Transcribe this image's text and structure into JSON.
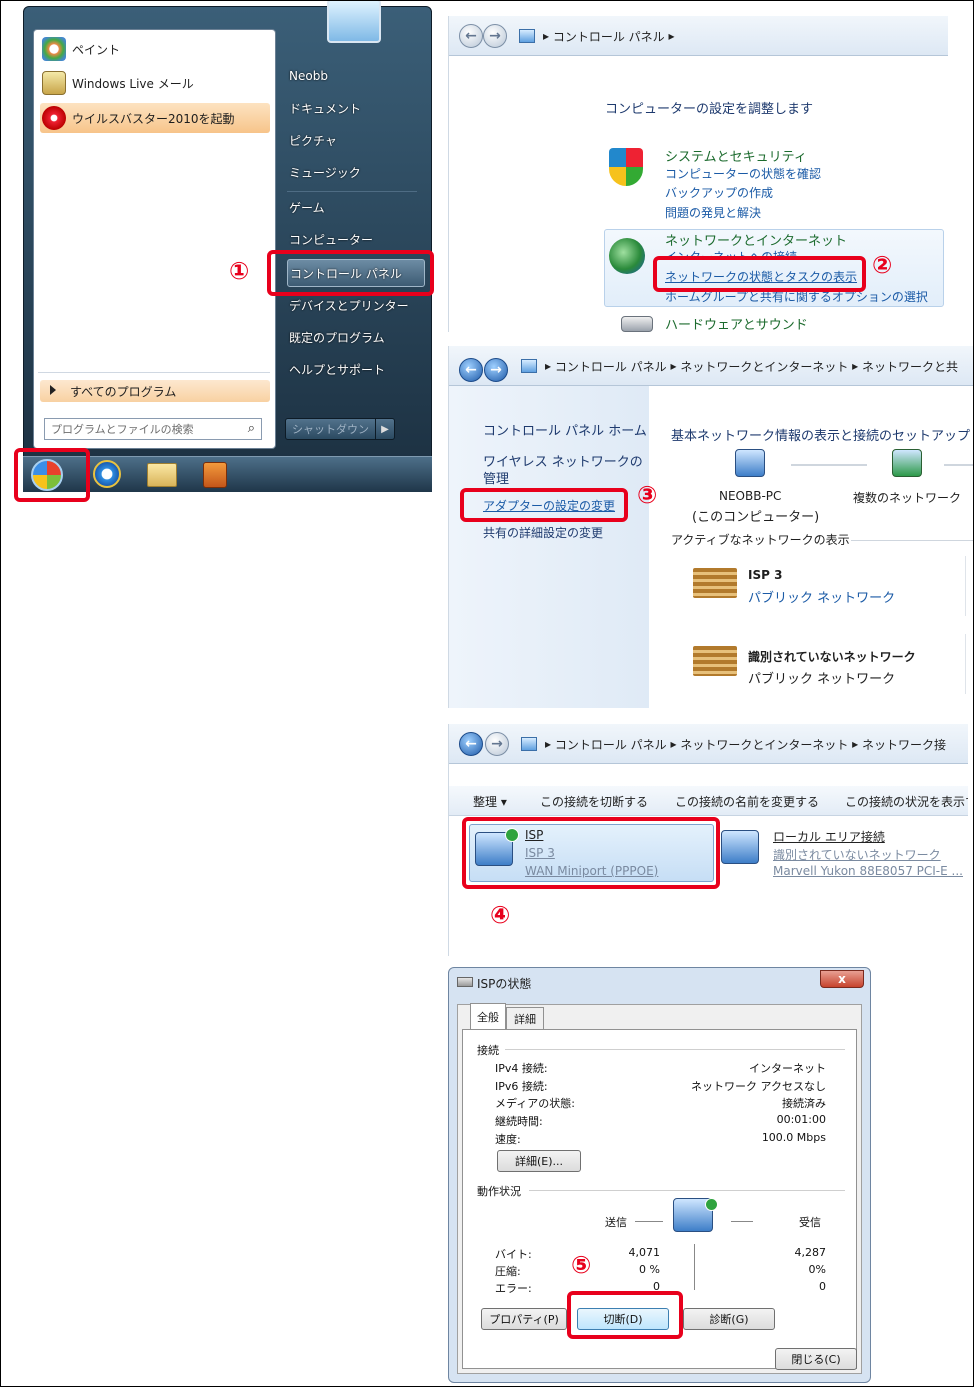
{
  "start_menu": {
    "pinned": [
      {
        "label": "ペイント",
        "icon": "paint-icon"
      },
      {
        "label": "Windows Live メール",
        "icon": "mail-icon"
      },
      {
        "label": "ウイルスバスター2010を起動",
        "icon": "virusbuster-icon"
      }
    ],
    "all_programs": "すべてのプログラム",
    "search_placeholder": "プログラムとファイルの検索",
    "right_items": [
      "Neobb",
      "ドキュメント",
      "ピクチャ",
      "ミュージック",
      "ゲーム",
      "コンピューター",
      "コントロール パネル",
      "デバイスとプリンター",
      "既定のプログラム",
      "ヘルプとサポート"
    ],
    "shutdown": "シャットダウン"
  },
  "steps": [
    "①",
    "②",
    "③",
    "④",
    "⑤"
  ],
  "pane1": {
    "breadcrumb": [
      "コントロール パネル"
    ],
    "heading": "コンピューターの設定を調整します",
    "system": {
      "title": "システムとセキュリティ",
      "links": [
        "コンピューターの状態を確認",
        "バックアップの作成",
        "問題の発見と解決"
      ]
    },
    "network": {
      "title": "ネットワークとインターネット",
      "links": [
        "インターネットへの接続",
        "ネットワークの状態とタスクの表示",
        "ホームグループと共有に関するオプションの選択"
      ]
    },
    "hardware": "ハードウェアとサウンド"
  },
  "pane2": {
    "breadcrumb": [
      "コントロール パネル",
      "ネットワークとインターネット",
      "ネットワークと共"
    ],
    "sidebar": [
      "コントロール パネル ホーム",
      "ワイヤレス ネットワークの管理",
      "アダプターの設定の変更",
      "共有の詳細設定の変更"
    ],
    "heading": "基本ネットワーク情報の表示と接続のセットアップ",
    "computer_name": "NEOBB-PC",
    "computer_sub": "(このコンピューター)",
    "multi_network": "複数のネットワーク",
    "active_heading": "アクティブなネットワークの表示",
    "networks": [
      {
        "name": "ISP  3",
        "type": "パブリック ネットワーク"
      },
      {
        "name": "識別されていないネットワーク",
        "type": "パブリック ネットワーク"
      }
    ]
  },
  "pane3": {
    "breadcrumb": [
      "コントロール パネル",
      "ネットワークとインターネット",
      "ネットワーク接"
    ],
    "toolbar": [
      "整理 ▾",
      "この接続を切断する",
      "この接続の名前を変更する",
      "この接続の状況を表示す"
    ],
    "connections": [
      {
        "name": "ISP",
        "network": "ISP  3",
        "device": "WAN Miniport (PPPOE)"
      },
      {
        "name": "ローカル エリア接続",
        "network": "識別されていないネットワーク",
        "device": "Marvell Yukon 88E8057 PCI-E ..."
      }
    ]
  },
  "dialog": {
    "title": "ISPの状態",
    "tabs": [
      "全般",
      "詳細"
    ],
    "connection_group": "接続",
    "rows": [
      {
        "label": "IPv4 接続:",
        "value": "インターネット"
      },
      {
        "label": "IPv6 接続:",
        "value": "ネットワーク アクセスなし"
      },
      {
        "label": "メディアの状態:",
        "value": "接続済み"
      },
      {
        "label": "継続時間:",
        "value": "00:01:00"
      },
      {
        "label": "速度:",
        "value": "100.0 Mbps"
      }
    ],
    "details_button": "詳細(E)...",
    "activity_group": "動作状況",
    "sent": "送信",
    "received": "受信",
    "stats": [
      {
        "label": "バイト:",
        "sent": "4,071",
        "received": "4,287"
      },
      {
        "label": "圧縮:",
        "sent": "0 %",
        "received": "0%"
      },
      {
        "label": "エラー:",
        "sent": "0",
        "received": "0"
      }
    ],
    "properties_button": "プロパティ(P)",
    "disconnect_button": "切断(D)",
    "diagnose_button": "診断(G)",
    "close_button": "閉じる(C)",
    "close_x": "x"
  }
}
